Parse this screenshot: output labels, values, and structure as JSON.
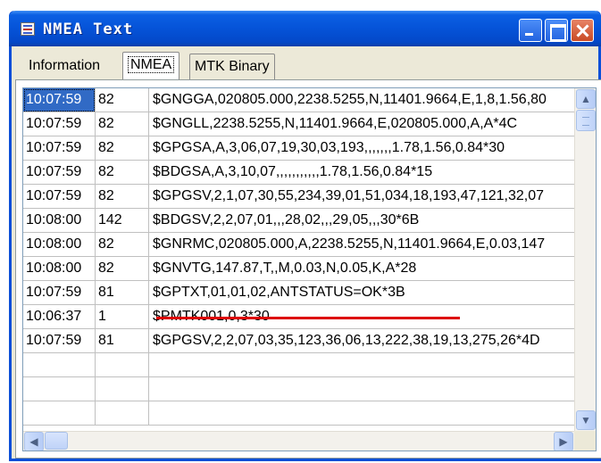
{
  "window": {
    "title": "NMEA Text",
    "minimize_icon": "minimize-icon",
    "maximize_icon": "maximize-icon",
    "close_icon": "close-icon"
  },
  "tabs": [
    {
      "label": "Information",
      "selected": false
    },
    {
      "label": "NMEA",
      "selected": true
    },
    {
      "label": "MTK Binary",
      "selected": false
    }
  ],
  "rows": [
    {
      "time": "10:07:59",
      "len": "82",
      "sentence": "$GNGGA,020805.000,2238.5255,N,11401.9664,E,1,8,1.56,80",
      "selected": true
    },
    {
      "time": "10:07:59",
      "len": "82",
      "sentence": "$GNGLL,2238.5255,N,11401.9664,E,020805.000,A,A*4C"
    },
    {
      "time": "10:07:59",
      "len": "82",
      "sentence": "$GPGSA,A,3,06,07,19,30,03,193,,,,,,,1.78,1.56,0.84*30"
    },
    {
      "time": "10:07:59",
      "len": "82",
      "sentence": "$BDGSA,A,3,10,07,,,,,,,,,,,1.78,1.56,0.84*15"
    },
    {
      "time": "10:07:59",
      "len": "82",
      "sentence": "$GPGSV,2,1,07,30,55,234,39,01,51,034,18,193,47,121,32,07"
    },
    {
      "time": "10:08:00",
      "len": "142",
      "sentence": "$BDGSV,2,2,07,01,,,28,02,,,29,05,,,30*6B"
    },
    {
      "time": "10:08:00",
      "len": "82",
      "sentence": "$GNRMC,020805.000,A,2238.5255,N,11401.9664,E,0.03,147"
    },
    {
      "time": "10:08:00",
      "len": "82",
      "sentence": "$GNVTG,147.87,T,,M,0.03,N,0.05,K,A*28"
    },
    {
      "time": "10:07:59",
      "len": "81",
      "sentence": "$GPTXT,01,01,02,ANTSTATUS=OK*3B"
    },
    {
      "time": "10:06:37",
      "len": "1",
      "sentence": "$PMTK001,0,3*30"
    },
    {
      "time": "10:07:59",
      "len": "81",
      "sentence": "$GPGSV,2,2,07,03,35,123,36,06,13,222,38,19,13,275,26*4D"
    },
    {
      "time": "",
      "len": "",
      "sentence": ""
    },
    {
      "time": "",
      "len": "",
      "sentence": ""
    },
    {
      "time": "",
      "len": "",
      "sentence": ""
    }
  ],
  "annotation": {
    "highlight_color": "#dd0000"
  },
  "scrollbar": {
    "up_icon": "scroll-up-icon",
    "down_icon": "scroll-down-icon",
    "left_icon": "scroll-left-icon",
    "right_icon": "scroll-right-icon"
  }
}
